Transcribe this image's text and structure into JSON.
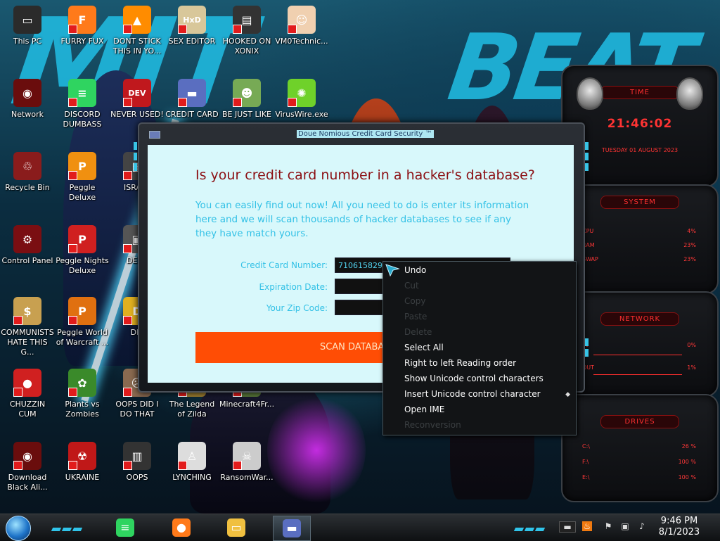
{
  "desktop": {
    "icons": [
      {
        "label": "This PC",
        "color": "#2b2b2b",
        "glyph": "▭"
      },
      {
        "label": "FURRY FUX",
        "color": "#ff7a1a",
        "glyph": "F"
      },
      {
        "label": "DONT STICK THIS IN YO...",
        "color": "#ff8c00",
        "glyph": "▲"
      },
      {
        "label": "SEX EDITOR",
        "color": "#d8c79a",
        "glyph": "HxD"
      },
      {
        "label": "HOOKED ON XONIX",
        "color": "#333333",
        "glyph": "▤"
      },
      {
        "label": "VM0Technic...",
        "color": "#f0d0b0",
        "glyph": "☺"
      },
      {
        "label": "Network",
        "color": "#6a0d0d",
        "glyph": "◉"
      },
      {
        "label": "DISCORD DUMBASS",
        "color": "#2fd460",
        "glyph": "≡"
      },
      {
        "label": "NEVER USED!",
        "color": "#c0181d",
        "glyph": "DEV"
      },
      {
        "label": "CREDIT CARD",
        "color": "#5a6ec0",
        "glyph": "▬"
      },
      {
        "label": "BE JUST LIKE",
        "color": "#77aa55",
        "glyph": "☻"
      },
      {
        "label": "VirusWire.exe",
        "color": "#6fd12a",
        "glyph": "✺"
      },
      {
        "label": "Recycle Bin",
        "color": "#8a1c1c",
        "glyph": "♲"
      },
      {
        "label": "Peggle Deluxe",
        "color": "#f09010",
        "glyph": "P"
      },
      {
        "label": "ISRAEL",
        "color": "#444444",
        "glyph": "▦"
      },
      {
        "label": "Control Panel",
        "color": "#7a0e12",
        "glyph": "⚙"
      },
      {
        "label": "Peggle Nights Deluxe",
        "color": "#d02020",
        "glyph": "P"
      },
      {
        "label": "DEEZ",
        "color": "#555555",
        "glyph": "▣"
      },
      {
        "label": "COMMUNISTS HATE THIS G...",
        "color": "#c8a050",
        "glyph": "$"
      },
      {
        "label": "Peggle World of Warcraft ...",
        "color": "#e07010",
        "glyph": "P"
      },
      {
        "label": "DIE",
        "color": "#e0b020",
        "glyph": "D"
      },
      {
        "label": "CHUZZIN CUM",
        "color": "#d02020",
        "glyph": "●"
      },
      {
        "label": "Plants vs Zombies",
        "color": "#3a8a2a",
        "glyph": "✿"
      },
      {
        "label": "OOPS DID I DO THAT",
        "color": "#8a6a50",
        "glyph": "☹"
      },
      {
        "label": "The Legend of Zilda",
        "color": "#a08030",
        "glyph": "⚔"
      },
      {
        "label": "Minecraft4Fr...",
        "color": "#5a7a3a",
        "glyph": "■"
      },
      {
        "label": "Download Black Ali...",
        "color": "#6a0d0d",
        "glyph": "◉"
      },
      {
        "label": "UKRAINE",
        "color": "#c01818",
        "glyph": "☢"
      },
      {
        "label": "OOPS",
        "color": "#333333",
        "glyph": "▥"
      },
      {
        "label": "LYNCHING",
        "color": "#dddddd",
        "glyph": "♙"
      },
      {
        "label": "RansomWar...",
        "color": "#cccccc",
        "glyph": "☠"
      }
    ]
  },
  "gadget": {
    "time": {
      "title": "TIME",
      "clock": "21:46:02",
      "date": "TUESDAY 01 AUGUST 2023"
    },
    "system": {
      "title": "SYSTEM",
      "rows": [
        {
          "label": "CPU",
          "value": "4%"
        },
        {
          "label": "RAM",
          "value": "23%"
        },
        {
          "label": "SWAP",
          "value": "23%"
        }
      ]
    },
    "network": {
      "title": "NETWORK",
      "rows": [
        {
          "label": "IN",
          "value": "0%"
        },
        {
          "label": "OUT",
          "value": "1%"
        }
      ]
    },
    "drives": {
      "title": "DRIVES",
      "rows": [
        {
          "label": "C:\\",
          "value": "26 %"
        },
        {
          "label": "F:\\",
          "value": "100 %"
        },
        {
          "label": "E:\\",
          "value": "100 %"
        }
      ]
    },
    "accent": "#ff2e2e"
  },
  "dialog": {
    "title": "Doue Nomious Credit Card Security ™",
    "heading": "Is your credit card number in a hacker's database?",
    "intro": "You can easily find out now! All you need to do is enter its information here and we will scan thousands of hacker databases to see if any they have match yours.",
    "fields": {
      "card_label": "Credit Card Number:",
      "card_value": "710615829",
      "expiry_label": "Expiration Date:",
      "expiry_value": "",
      "zip_label": "Your Zip Code:",
      "zip_value": ""
    },
    "scan_button": "SCAN DATABASES",
    "colors": {
      "heading": "#8b0f13",
      "text": "#33c1e6",
      "button": "#ff4d05",
      "background": "#d8f8fb"
    }
  },
  "context_menu": {
    "items": [
      {
        "label": "Undo",
        "enabled": true
      },
      {
        "label": "Cut",
        "enabled": false
      },
      {
        "label": "Copy",
        "enabled": false
      },
      {
        "label": "Paste",
        "enabled": false
      },
      {
        "label": "Delete",
        "enabled": false
      },
      {
        "label": "Select All",
        "enabled": true
      },
      {
        "label": "Right to left Reading order",
        "enabled": true
      },
      {
        "label": "Show Unicode control characters",
        "enabled": true
      },
      {
        "label": "Insert Unicode control character",
        "enabled": true,
        "submenu": true
      },
      {
        "label": "Open IME",
        "enabled": true
      },
      {
        "label": "Reconversion",
        "enabled": false
      }
    ]
  },
  "taskbar": {
    "pinned": [
      {
        "name": "discord",
        "color": "#2fd460",
        "glyph": "≡"
      },
      {
        "name": "firefox",
        "color": "#ff7a1a",
        "glyph": "●"
      },
      {
        "name": "file-explorer",
        "color": "#f0c040",
        "glyph": "▭"
      },
      {
        "name": "credit-card-app",
        "color": "#5a6ec0",
        "glyph": "▬",
        "active": true
      }
    ],
    "clock_time": "9:46 PM",
    "clock_date": "8/1/2023"
  }
}
